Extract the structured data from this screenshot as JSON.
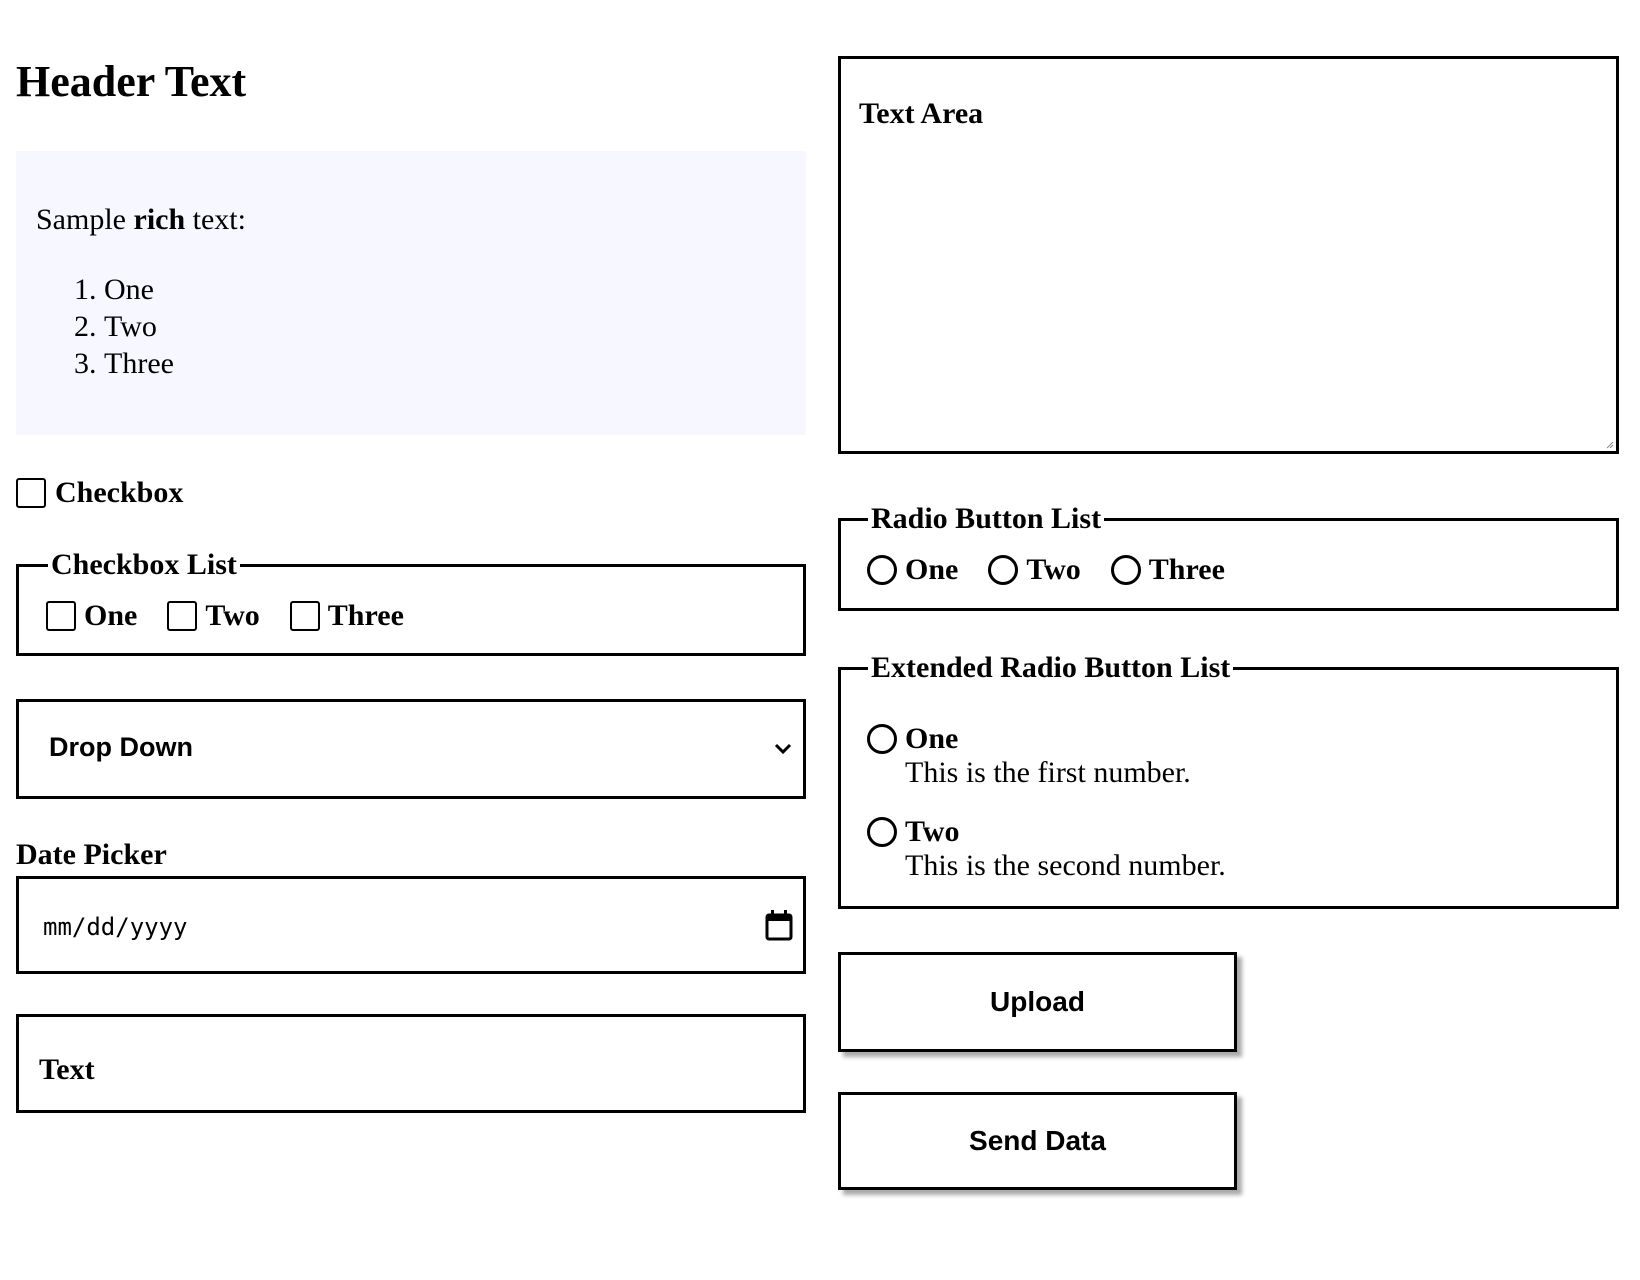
{
  "header": {
    "title": "Header Text"
  },
  "rich_text": {
    "prefix": "Sample ",
    "bold": "rich",
    "suffix": " text:",
    "items": [
      "One",
      "Two",
      "Three"
    ]
  },
  "checkbox": {
    "label": "Checkbox",
    "checked": false
  },
  "checkbox_list": {
    "legend": "Checkbox List",
    "options": [
      {
        "label": "One",
        "checked": false
      },
      {
        "label": "Two",
        "checked": false
      },
      {
        "label": "Three",
        "checked": false
      }
    ]
  },
  "dropdown": {
    "value": "Drop Down"
  },
  "date_picker": {
    "label": "Date Picker",
    "placeholder": "mm/dd/yyyy"
  },
  "text_input": {
    "placeholder": "Text"
  },
  "text_area": {
    "placeholder": "Text Area"
  },
  "radio_list": {
    "legend": "Radio Button List",
    "options": [
      {
        "label": "One"
      },
      {
        "label": "Two"
      },
      {
        "label": "Three"
      }
    ]
  },
  "extended_radio_list": {
    "legend": "Extended Radio Button List",
    "options": [
      {
        "label": "One",
        "description": "This is the first number."
      },
      {
        "label": "Two",
        "description": "This is the second number."
      }
    ]
  },
  "buttons": {
    "upload": "Upload",
    "send": "Send Data"
  }
}
